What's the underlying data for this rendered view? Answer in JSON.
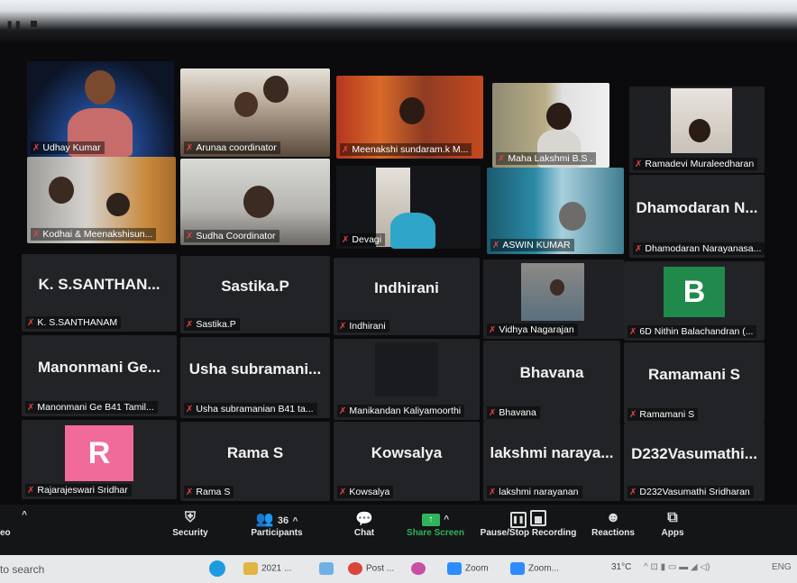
{
  "colors": {
    "accent_green": "#2fb35c",
    "mic_muted": "#e5433d",
    "avatar_pink": "#f06b9a",
    "avatar_green": "#1f8a4c"
  },
  "participants": [
    {
      "label": "Udhay Kumar",
      "big": ""
    },
    {
      "label": "Arunaa coordinator",
      "big": ""
    },
    {
      "label": "Meenakshi sundaram.k M...",
      "big": ""
    },
    {
      "label": "Maha Lakshmi B.S .",
      "big": ""
    },
    {
      "label": "Ramadevi Muraleedharan",
      "big": ""
    },
    {
      "label": "Kodhai & Meenakshisun...",
      "big": ""
    },
    {
      "label": "Sudha Coordinator",
      "big": ""
    },
    {
      "label": "Devagi",
      "big": ""
    },
    {
      "label": "ASWIN KUMAR",
      "big": ""
    },
    {
      "label": "Dhamodaran Narayanasa...",
      "big": "Dhamodaran  N..."
    },
    {
      "label": "K. S.SANTHANAM",
      "big": "K.  S.SANTHAN..."
    },
    {
      "label": "Sastika.P",
      "big": "Sastika.P"
    },
    {
      "label": "Indhirani",
      "big": "Indhirani"
    },
    {
      "label": "Vidhya Nagarajan",
      "big": ""
    },
    {
      "label": "6D Nithin Balachandran (...",
      "big": "",
      "avatar": "B"
    },
    {
      "label": "Manonmani Ge B41 Tamil...",
      "big": "Manonmani  Ge..."
    },
    {
      "label": "Usha subramanian B41 ta...",
      "big": "Usha  subramani..."
    },
    {
      "label": "Manikandan Kaliyamoorthi",
      "big": ""
    },
    {
      "label": "Bhavana",
      "big": "Bhavana"
    },
    {
      "label": "Ramamani S",
      "big": "Ramamani S"
    },
    {
      "label": "Rajarajeswari Sridhar",
      "big": "",
      "avatar": "R"
    },
    {
      "label": "Rama S",
      "big": "Rama S"
    },
    {
      "label": "Kowsalya",
      "big": "Kowsalya"
    },
    {
      "label": "lakshmi narayanan",
      "big": "lakshmi  naraya..."
    },
    {
      "label": "D232Vasumathi Sridharan",
      "big": "D232Vasumathi..."
    }
  ],
  "toolbar": {
    "security": "Security",
    "participants": "Participants",
    "participants_count": "36",
    "chat": "Chat",
    "share": "Share Screen",
    "record": "Pause/Stop Recording",
    "reactions": "Reactions",
    "apps": "Apps",
    "left_partial": "eo"
  },
  "taskbar": {
    "search": "to search",
    "item1": "2021 ...",
    "item2": "Post ...",
    "item3": "Zoom",
    "item4": "Zoom...",
    "weather": "31°C",
    "lang": "ENG"
  }
}
